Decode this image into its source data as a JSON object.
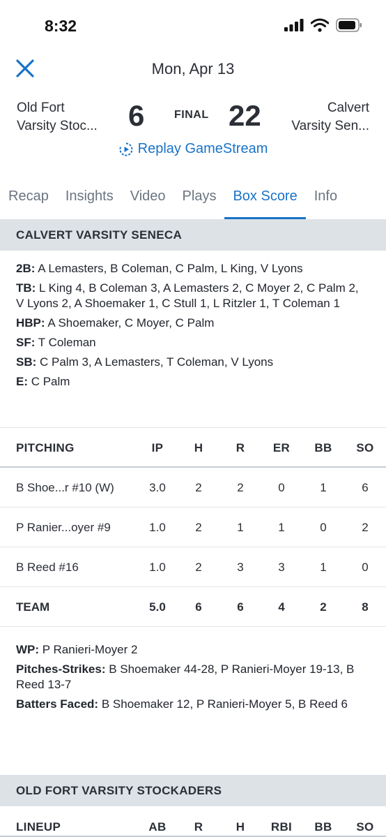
{
  "status": {
    "time": "8:32"
  },
  "header": {
    "title": "Mon, Apr 13"
  },
  "game": {
    "away_team_line1": "Old Fort",
    "away_team_line2": "Varsity Stoc...",
    "away_score": "6",
    "status": "FINAL",
    "home_score": "22",
    "home_team_line1": "Calvert",
    "home_team_line2": "Varsity Sen...",
    "replay_label": "Replay GameStream"
  },
  "tabs": [
    {
      "label": "Recap"
    },
    {
      "label": "Insights"
    },
    {
      "label": "Video"
    },
    {
      "label": "Plays"
    },
    {
      "label": "Box Score"
    },
    {
      "label": "Info"
    }
  ],
  "calvert": {
    "section_title": "CALVERT VARSITY SENECA",
    "notes": [
      {
        "label": "2B:",
        "text": " A Lemasters, B Coleman, C Palm, L King, V Lyons"
      },
      {
        "label": "TB:",
        "text": " L King 4, B Coleman 3, A Lemasters 2, C Moyer 2, C Palm 2, V Lyons 2, A Shoemaker 1, C Stull 1, L Ritzler 1, T Coleman 1"
      },
      {
        "label": "HBP:",
        "text": " A Shoemaker, C Moyer, C Palm"
      },
      {
        "label": "SF:",
        "text": " T Coleman"
      },
      {
        "label": "SB:",
        "text": " C Palm 3, A Lemasters, T Coleman, V Lyons"
      },
      {
        "label": "E:",
        "text": " C Palm"
      }
    ],
    "pitching": {
      "headers": [
        "PITCHING",
        "IP",
        "H",
        "R",
        "ER",
        "BB",
        "SO"
      ],
      "rows": [
        [
          "B Shoe...r #10 (W)",
          "3.0",
          "2",
          "2",
          "0",
          "1",
          "6"
        ],
        [
          "P Ranier...oyer #9",
          "1.0",
          "2",
          "1",
          "1",
          "0",
          "2"
        ],
        [
          "B Reed #16",
          "1.0",
          "2",
          "3",
          "3",
          "1",
          "0"
        ]
      ],
      "team": [
        "TEAM",
        "5.0",
        "6",
        "6",
        "4",
        "2",
        "8"
      ]
    },
    "pitching_notes": [
      {
        "label": "WP:",
        "text": " P Ranieri-Moyer 2"
      },
      {
        "label": "Pitches-Strikes:",
        "text": " B Shoemaker 44-28, P Ranieri-Moyer 19-13, B Reed 13-7"
      },
      {
        "label": "Batters Faced:",
        "text": " B Shoemaker 12, P Ranieri-Moyer 5, B Reed 6"
      }
    ]
  },
  "oldfort": {
    "section_title": "OLD FORT VARSITY STOCKADERS",
    "lineup_headers": [
      "LINEUP",
      "AB",
      "R",
      "H",
      "RBI",
      "BB",
      "SO"
    ]
  },
  "colors": {
    "accent": "#1a73c7",
    "section_bg": "#dde2e7"
  }
}
